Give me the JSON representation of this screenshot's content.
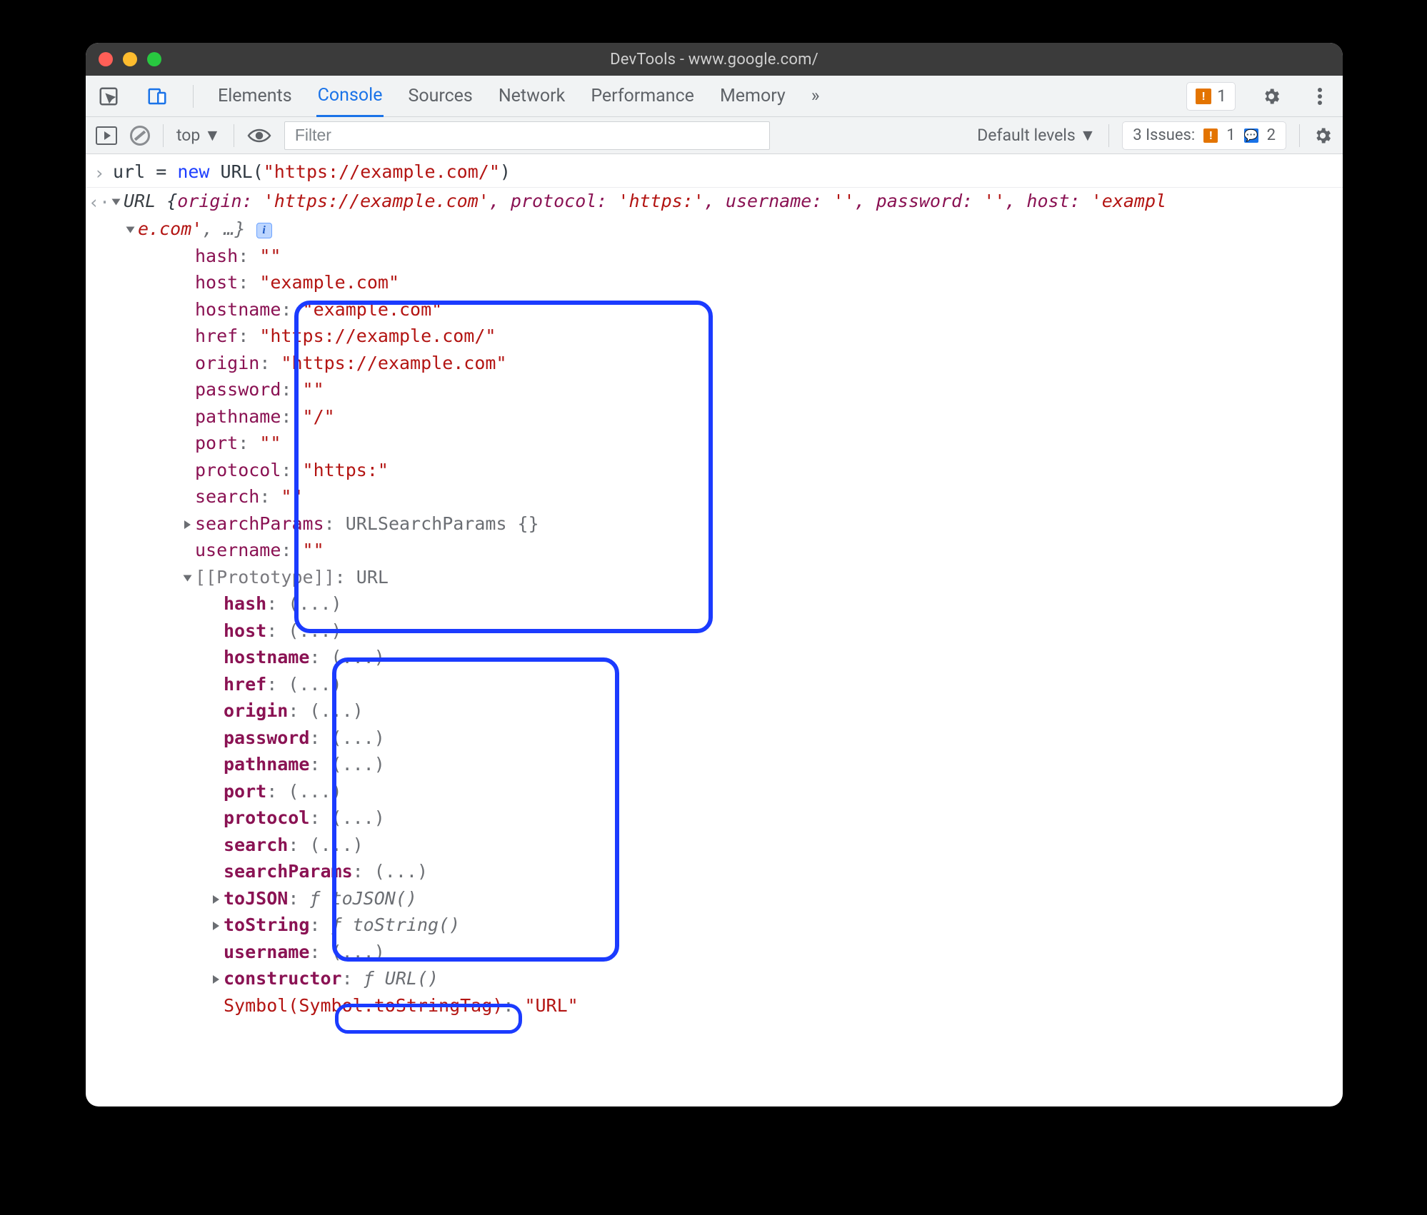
{
  "window": {
    "title": "DevTools - www.google.com/"
  },
  "tabs": {
    "elements": "Elements",
    "console": "Console",
    "sources": "Sources",
    "network": "Network",
    "performance": "Performance",
    "memory": "Memory",
    "more": "»"
  },
  "badge_count": "1",
  "toolbar": {
    "context": "top ▼",
    "filter_placeholder": "Filter",
    "levels": "Default levels ▼",
    "issues_label": "3 Issues:",
    "issues_warn": "1",
    "issues_info": "2"
  },
  "console": {
    "input_line_prefix": "url = ",
    "input_line_new": "new",
    "input_line_class": " URL",
    "input_line_open": "(",
    "input_line_str": "\"https://example.com/\"",
    "input_line_close": ")",
    "result_head_class": "URL ",
    "result_head_brace": "{",
    "pairs": {
      "origin_k": "origin: ",
      "origin_v": "'https://example.com'",
      "protocol_k": ", protocol: ",
      "protocol_v": "'https:'",
      "username_k": ", username: ",
      "username_v": "''",
      "password_k": ", password: ",
      "password_v": "''",
      "host_k": ", host: ",
      "host_v": "'exampl"
    },
    "wrap_line": "e.com'",
    "wrap_tail": ", …} ",
    "props": [
      {
        "k": "hash",
        "v": "\"\""
      },
      {
        "k": "host",
        "v": "\"example.com\""
      },
      {
        "k": "hostname",
        "v": "\"example.com\""
      },
      {
        "k": "href",
        "v": "\"https://example.com/\""
      },
      {
        "k": "origin",
        "v": "\"https://example.com\""
      },
      {
        "k": "password",
        "v": "\"\""
      },
      {
        "k": "pathname",
        "v": "\"/\""
      },
      {
        "k": "port",
        "v": "\"\""
      },
      {
        "k": "protocol",
        "v": "\"https:\""
      },
      {
        "k": "search",
        "v": "\"\""
      }
    ],
    "searchParams_k": "searchParams",
    "searchParams_v": "URLSearchParams {}",
    "username_own_k": "username",
    "username_own_v": "\"\"",
    "proto_label": "[[Prototype]]",
    "proto_val": "URL",
    "getters": [
      "hash",
      "host",
      "hostname",
      "href",
      "origin",
      "password",
      "pathname",
      "port",
      "protocol",
      "search",
      "searchParams"
    ],
    "getter_val": "(...)",
    "toJSON_k": "toJSON",
    "toJSON_v": "ƒ toJSON()",
    "toString_k": "toString",
    "toString_v": "ƒ toString()",
    "proto_username_k": "username",
    "proto_username_v": "(...)",
    "constructor_k": "constructor",
    "constructor_v": "ƒ URL()",
    "symbol_k": "Symbol(Symbol.toStringTag)",
    "symbol_v": "\"URL\""
  }
}
